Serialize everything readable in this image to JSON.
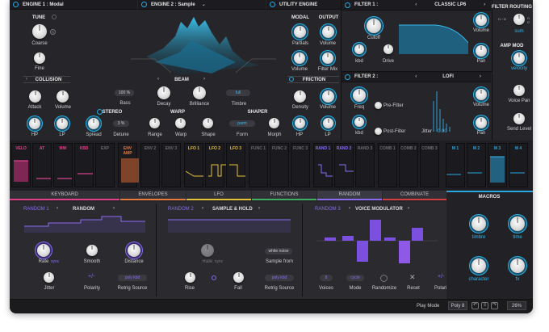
{
  "colors": {
    "accent": "#29a7e1",
    "purple": "#8a6cf0",
    "bg": "#26262a"
  },
  "engine1": {
    "title": "ENGINE 1 : Modal",
    "tune": "TUNE",
    "coarse": "Coarse",
    "fine": "Fine",
    "collision": "COLLISION",
    "attack": "Attack",
    "volume": "Volume",
    "hp": "HP",
    "lp": "LP"
  },
  "engine2": {
    "title": "ENGINE 2 : Sample",
    "beam": "BEAM",
    "bass_value": "100 %",
    "bass": "Bass",
    "decay": "Decay",
    "brilliance": "Brilliance",
    "timbre_value": "full",
    "timbre": "Timbre",
    "stereo": "STEREO",
    "spread": "Spread",
    "detune_value": "3 %",
    "detune": "Detune",
    "warp": "WARP",
    "range": "Range",
    "warp_knob": "Warp",
    "shape": "Shape",
    "shaper": "SHAPER",
    "form_value": "parm",
    "form": "Form",
    "morph": "Morph"
  },
  "utility": {
    "title": "UTILITY ENGINE",
    "modal": "MODAL",
    "output": "OUTPUT",
    "partials": "Partials",
    "volume": "Volume",
    "volume2": "Volume",
    "filter_mix": "Filter Mix",
    "friction": "FRICTION",
    "density": "Density",
    "fr_volume": "Volume",
    "hp": "HP",
    "lp": "LP"
  },
  "filter1": {
    "title": "FILTER 1 :",
    "type": "CLASSIC LP6",
    "cutoff": "Cutoff",
    "kbd": "kbd",
    "drive": "Drive",
    "volume": "Volume",
    "pan": "Pan"
  },
  "filter2": {
    "title": "FILTER 2 :",
    "type": "LOFI",
    "freq": "Freq",
    "prefilter": "Pre-Filter",
    "kbd": "kbd",
    "postfilter": "Post-Filter",
    "jitter": "Jitter",
    "jitter_value": "0.00",
    "volume": "Volume",
    "pan": "Pan"
  },
  "right": {
    "routing": "FILTER ROUTING",
    "sum": "sum",
    "ampmod": "AMP MOD",
    "velocity": "velocity",
    "voicepan": "Voice Pan",
    "sendlevel": "Send Level"
  },
  "mod_slots": [
    {
      "label": "VELO",
      "color": "#e0408a"
    },
    {
      "label": "AT",
      "color": "#e0408a"
    },
    {
      "label": "MW",
      "color": "#e0408a"
    },
    {
      "label": "KBD",
      "color": "#e0408a"
    },
    {
      "label": "EXP",
      "color": "#6a6a70"
    },
    {
      "label": "ENV AMP",
      "color": "#e57a3c"
    },
    {
      "label": "ENV 2",
      "color": "#6a6a70"
    },
    {
      "label": "ENV 3",
      "color": "#6a6a70"
    },
    {
      "label": "LFO 1",
      "color": "#e3c23a"
    },
    {
      "label": "LFO 2",
      "color": "#e3c23a"
    },
    {
      "label": "LFO 3",
      "color": "#e3c23a"
    },
    {
      "label": "FUNC 1",
      "color": "#6a6a70"
    },
    {
      "label": "FUNC 2",
      "color": "#6a6a70"
    },
    {
      "label": "FUNC 3",
      "color": "#6a6a70"
    },
    {
      "label": "RAND 1",
      "color": "#8a6cf0"
    },
    {
      "label": "RAND 2",
      "color": "#8a6cf0"
    },
    {
      "label": "RAND 3",
      "color": "#6a6a70"
    },
    {
      "label": "COMB 1",
      "color": "#6a6a70"
    },
    {
      "label": "COMB 2",
      "color": "#6a6a70"
    },
    {
      "label": "COMB 3",
      "color": "#6a6a70"
    },
    {
      "label": "M 1",
      "color": "#29a7e1"
    },
    {
      "label": "M 2",
      "color": "#29a7e1"
    },
    {
      "label": "M 3",
      "color": "#29a7e1"
    },
    {
      "label": "M 4",
      "color": "#29a7e1"
    }
  ],
  "tabs": [
    "KEYBOARD",
    "ENVELOPES",
    "LFO",
    "FUNCTIONS",
    "RANDOM",
    "COMBINATE"
  ],
  "random1": {
    "name": "RANDOM 1",
    "type": "RANDOM",
    "rate": "Rate",
    "rate_unit": "sync",
    "smooth": "Smooth",
    "distance": "Distance",
    "jitter": "Jitter",
    "polarity": "Polarity",
    "retrig_value": "poly kbd",
    "retrig": "Retrig Source"
  },
  "random2": {
    "name": "RANDOM 2",
    "type": "SAMPLE & HOLD",
    "rate": "Rate",
    "rate_unit": "sync",
    "sample_value": "white noise",
    "sample": "Sample from",
    "rise": "Rise",
    "fall": "Fall",
    "retrig_value": "poly kbd",
    "retrig": "Retrig Source"
  },
  "random3": {
    "name": "RANDOM 3",
    "type": "VOICE MODULATOR",
    "voices_value": "8",
    "voices": "Voices",
    "mode_value": "cycle",
    "mode": "Mode",
    "randomize": "Randomize",
    "reset": "Reset",
    "polarity": "Polarity"
  },
  "macros": {
    "title": "MACROS",
    "timbre": "timbre",
    "time": "time",
    "character": "character",
    "fx": "fx"
  },
  "status": {
    "playmode": "Play Mode",
    "poly": "Poly 8",
    "zoom": "26%"
  }
}
